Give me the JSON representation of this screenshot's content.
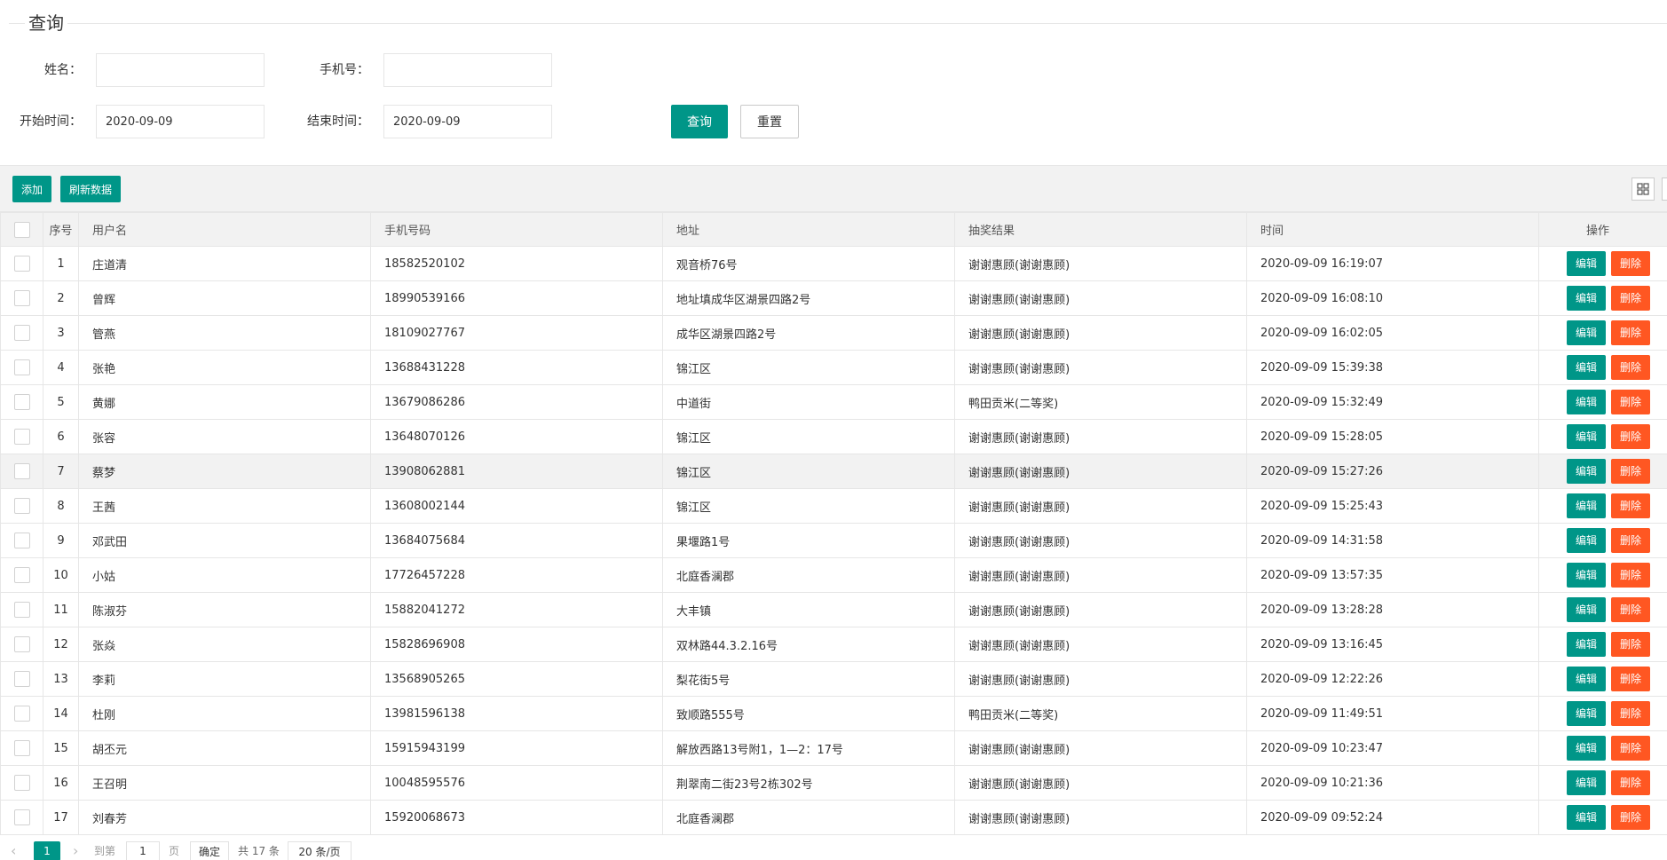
{
  "query": {
    "legend": "查询",
    "name_label": "姓名：",
    "name_value": "",
    "phone_label": "手机号：",
    "phone_value": "",
    "start_label": "开始时间：",
    "start_value": "2020-09-09",
    "end_label": "结束时间：",
    "end_value": "2020-09-09",
    "query_button": "查询",
    "reset_button": "重置"
  },
  "toolbar": {
    "add_button": "添加",
    "refresh_button": "刷新数据",
    "columns_icon": "grid-icon"
  },
  "table": {
    "headers": [
      "序号",
      "用户名",
      "手机号码",
      "地址",
      "抽奖结果",
      "时间",
      "操作"
    ],
    "edit_label": "编辑",
    "delete_label": "删除",
    "rows": [
      {
        "no": "1",
        "name": "庄道清",
        "phone": "18582520102",
        "address": "观音桥76号",
        "result": "谢谢惠顾(谢谢惠顾)",
        "time": "2020-09-09 16:19:07"
      },
      {
        "no": "2",
        "name": "曾辉",
        "phone": "18990539166",
        "address": "地址填成华区湖景四路2号",
        "result": "谢谢惠顾(谢谢惠顾)",
        "time": "2020-09-09 16:08:10"
      },
      {
        "no": "3",
        "name": "管燕",
        "phone": "18109027767",
        "address": "成华区湖景四路2号",
        "result": "谢谢惠顾(谢谢惠顾)",
        "time": "2020-09-09 16:02:05"
      },
      {
        "no": "4",
        "name": "张艳",
        "phone": "13688431228",
        "address": "锦江区",
        "result": "谢谢惠顾(谢谢惠顾)",
        "time": "2020-09-09 15:39:38"
      },
      {
        "no": "5",
        "name": "黄娜",
        "phone": "13679086286",
        "address": "中道街",
        "result": "鸭田贡米(二等奖)",
        "time": "2020-09-09 15:32:49"
      },
      {
        "no": "6",
        "name": "张容",
        "phone": "13648070126",
        "address": "锦江区",
        "result": "谢谢惠顾(谢谢惠顾)",
        "time": "2020-09-09 15:28:05"
      },
      {
        "no": "7",
        "name": "蔡梦",
        "phone": "13908062881",
        "address": "锦江区",
        "result": "谢谢惠顾(谢谢惠顾)",
        "time": "2020-09-09 15:27:26"
      },
      {
        "no": "8",
        "name": "王茜",
        "phone": "13608002144",
        "address": "锦江区",
        "result": "谢谢惠顾(谢谢惠顾)",
        "time": "2020-09-09 15:25:43"
      },
      {
        "no": "9",
        "name": "邓武田",
        "phone": "13684075684",
        "address": "果堰路1号",
        "result": "谢谢惠顾(谢谢惠顾)",
        "time": "2020-09-09 14:31:58"
      },
      {
        "no": "10",
        "name": "小姑",
        "phone": "17726457228",
        "address": "北庭香澜郡",
        "result": "谢谢惠顾(谢谢惠顾)",
        "time": "2020-09-09 13:57:35"
      },
      {
        "no": "11",
        "name": "陈淑芬",
        "phone": "15882041272",
        "address": "大丰镇",
        "result": "谢谢惠顾(谢谢惠顾)",
        "time": "2020-09-09 13:28:28"
      },
      {
        "no": "12",
        "name": "张焱",
        "phone": "15828696908",
        "address": "双林路44.3.2.16号",
        "result": "谢谢惠顾(谢谢惠顾)",
        "time": "2020-09-09 13:16:45"
      },
      {
        "no": "13",
        "name": "李莉",
        "phone": "13568905265",
        "address": "梨花街5号",
        "result": "谢谢惠顾(谢谢惠顾)",
        "time": "2020-09-09 12:22:26"
      },
      {
        "no": "14",
        "name": "杜刚",
        "phone": "13981596138",
        "address": "致顺路555号",
        "result": "鸭田贡米(二等奖)",
        "time": "2020-09-09 11:49:51"
      },
      {
        "no": "15",
        "name": "胡丕元",
        "phone": "15915943199",
        "address": "解放西路13号附1，1—2：17号",
        "result": "谢谢惠顾(谢谢惠顾)",
        "time": "2020-09-09 10:23:47"
      },
      {
        "no": "16",
        "name": "王召明",
        "phone": "10048595576",
        "address": "荆翠南二街23号2栋302号",
        "result": "谢谢惠顾(谢谢惠顾)",
        "time": "2020-09-09 10:21:36"
      },
      {
        "no": "17",
        "name": "刘春芳",
        "phone": "15920068673",
        "address": "北庭香澜郡",
        "result": "谢谢惠顾(谢谢惠顾)",
        "time": "2020-09-09 09:52:24"
      }
    ]
  },
  "pager": {
    "prev_icon": "chevron-left-icon",
    "current_page": "1",
    "next_icon": "chevron-right-icon",
    "goto_label": "到第",
    "goto_value": "1",
    "page_unit": "页",
    "confirm_button": "确定",
    "total_text": "共 17 条",
    "page_size": "20 条/页"
  },
  "colors": {
    "primary": "#009688",
    "danger": "#ff5722",
    "header_bg": "#f2f2f2"
  }
}
